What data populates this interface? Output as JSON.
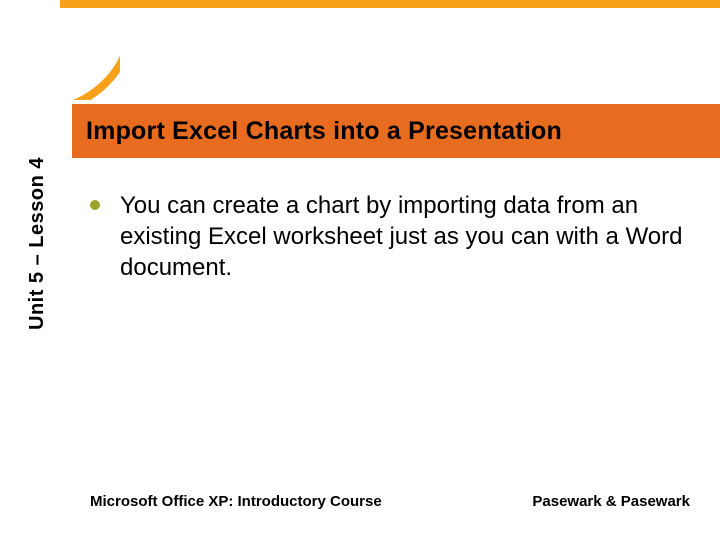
{
  "header": {
    "title": "Import Excel Charts into a Presentation"
  },
  "sidebar": {
    "label": "Unit 5 – Lesson 4"
  },
  "content": {
    "bullets": [
      "You can create a chart by importing data from an existing Excel worksheet just as you can with a Word document."
    ]
  },
  "footer": {
    "left": "Microsoft Office XP:  Introductory Course",
    "right": "Pasewark & Pasewark"
  },
  "colors": {
    "accent_orange": "#f7a11a",
    "band_orange": "#e86c1f",
    "bullet_olive": "#9aa42b"
  }
}
